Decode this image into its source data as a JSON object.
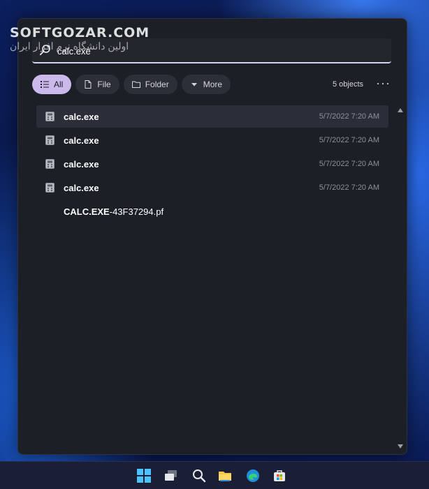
{
  "watermark": {
    "brand": "SOFTGOZAR.COM",
    "tagline": "اولین دانشگاه نرم افزار ایران"
  },
  "search": {
    "value": "calc.exe",
    "icon": "search-icon"
  },
  "filters": [
    {
      "label": "All",
      "icon": "list-icon",
      "active": true
    },
    {
      "label": "File",
      "icon": "file-icon",
      "active": false
    },
    {
      "label": "Folder",
      "icon": "folder-icon",
      "active": false
    },
    {
      "label": "More",
      "icon": "caret-down-icon",
      "active": false
    }
  ],
  "result_count": "5 objects",
  "results": [
    {
      "name": "calc.exe",
      "rest": "",
      "date": "5/7/2022 7:20 AM",
      "selected": true
    },
    {
      "name": "calc.exe",
      "rest": "",
      "date": "5/7/2022 7:20 AM",
      "selected": false
    },
    {
      "name": "calc.exe",
      "rest": "",
      "date": "5/7/2022 7:20 AM",
      "selected": false
    },
    {
      "name": "calc.exe",
      "rest": "",
      "date": "5/7/2022 7:20 AM",
      "selected": false
    },
    {
      "name": "CALC.EXE",
      "rest": "-43F37294.pf",
      "date": "",
      "selected": false
    }
  ],
  "taskbar": [
    "windows-start-icon",
    "task-view-icon",
    "search-icon",
    "file-explorer-icon",
    "edge-browser-icon",
    "store-icon"
  ],
  "colors": {
    "accent": "#cbb9ec",
    "panel": "#1d1f27"
  }
}
